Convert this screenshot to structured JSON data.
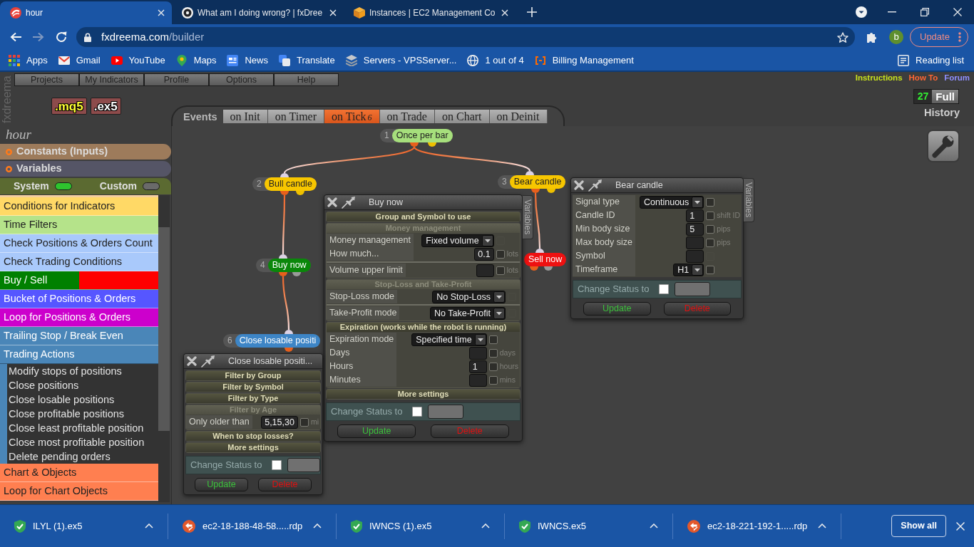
{
  "browser": {
    "tabs": [
      {
        "title": "hour",
        "kind": "swirl",
        "selected": true
      },
      {
        "title": "What am I doing wrong? | fxDree",
        "kind": "ring",
        "selected": false
      },
      {
        "title": "Instances | EC2 Management Co",
        "kind": "cube",
        "selected": false
      }
    ],
    "navigation": [
      {
        "kind": "back",
        "disabled": false
      },
      {
        "kind": "forward",
        "disabled": true
      },
      {
        "kind": "reload",
        "disabled": false
      }
    ],
    "address": {
      "host": "fxdreema.com",
      "path": "/builder"
    },
    "profile": "b",
    "update_button": "Update",
    "bookmarks": [
      {
        "label": "Apps",
        "kind": "grid"
      },
      {
        "label": "Gmail",
        "kind": "mail"
      },
      {
        "label": "YouTube",
        "kind": "video"
      },
      {
        "label": "Maps",
        "kind": "pin"
      },
      {
        "label": "News",
        "kind": "news"
      },
      {
        "label": "Translate",
        "kind": "squares"
      },
      {
        "label": "Servers - VPSServer...",
        "kind": "layers"
      },
      {
        "label": "1 out of 4",
        "kind": "globe"
      },
      {
        "label": "Billing Management",
        "kind": "brackets"
      }
    ],
    "reading_list": "Reading list"
  },
  "app": {
    "brand": "fxdreema",
    "menu": [
      "Projects",
      "My Indicators",
      "Profile",
      "Options",
      "Help"
    ],
    "export_buttons": [
      {
        "label": ".mq5",
        "kind": "source"
      },
      {
        "label": ".ex5",
        "kind": "binary"
      }
    ],
    "events": {
      "label": "Events",
      "tabs": [
        {
          "label": "on Init",
          "selected": false
        },
        {
          "label": "on Timer",
          "selected": false
        },
        {
          "label": "on Tick",
          "count": "6",
          "selected": true
        },
        {
          "label": "on Trade",
          "selected": false
        },
        {
          "label": "on Chart",
          "selected": false
        },
        {
          "label": "on Deinit",
          "selected": false
        }
      ]
    },
    "links": [
      {
        "label": "Instructions",
        "color": "#c8e21c"
      },
      {
        "label": "How To",
        "color": "#ff6633"
      },
      {
        "label": "Forum",
        "color": "#8f8fff"
      }
    ],
    "counter": {
      "value": "27",
      "label": "Full"
    },
    "history": "History",
    "project": "hour",
    "sections": [
      {
        "label": "Constants (Inputs)",
        "color": "#9d7b5b"
      },
      {
        "label": "Variables",
        "color": "#555566"
      }
    ],
    "toggles": [
      {
        "label": "System",
        "on": true
      },
      {
        "label": "Custom",
        "on": false
      }
    ],
    "categories": [
      {
        "label": "Conditions for Indicators",
        "color": "#ffd966",
        "expanded": false
      },
      {
        "label": "Time Filters",
        "color": "#b5e38a",
        "expanded": false
      },
      {
        "label": "Check Positions & Orders Count",
        "color": "#a9c9fb",
        "expanded": false
      },
      {
        "label": "Check Trading Conditions",
        "color": "#a9c9fb",
        "expanded": false
      },
      {
        "label": "Buy / Sell",
        "color": "#008000",
        "second_half": {
          "color": "#ff0000"
        },
        "expanded": false
      },
      {
        "label": "Bucket of Positions & Orders",
        "color": "#5656ff",
        "expanded": false
      },
      {
        "label": "Loop for Positions & Orders",
        "color": "#cc00cc",
        "expanded": false
      },
      {
        "label": "Trailing Stop / Break Even",
        "color": "#4a86b8",
        "expanded": false
      },
      {
        "label": "Trading Actions",
        "color": "#4a86b8",
        "expanded": true,
        "children": [
          {
            "label": "Modify stops of positions"
          },
          {
            "label": "Close positions"
          },
          {
            "label": "Close losable positions"
          },
          {
            "label": "Close profitable positions"
          },
          {
            "label": "Close least profitable position"
          },
          {
            "label": "Close most profitable position"
          },
          {
            "label": "Delete pending orders"
          }
        ]
      },
      {
        "label": "Chart & Objects",
        "color": "#ff7f50",
        "expanded": false
      },
      {
        "label": "Loop for Chart Objects",
        "color": "#ff7f50",
        "expanded": false
      }
    ],
    "nodes": [
      {
        "number": "1",
        "label": "Once per bar",
        "color": "#a6df7c",
        "outputs": [
          {
            "color": "#e8601c"
          },
          {
            "color": "#eec000"
          }
        ],
        "children": [
          {
            "number": "2",
            "label": "Bull candle",
            "color": "#f7c600",
            "outputs": [
              {
                "color": "#e8601c"
              },
              {
                "color": "#eec000"
              }
            ],
            "children": [
              {
                "number": "4",
                "label": "Buy now",
                "color": "#0a870a",
                "outputs": [
                  {
                    "color": "#e8601c"
                  },
                  {
                    "color": "#9a9a9a"
                  }
                ],
                "children": [
                  {
                    "number": "6",
                    "label": "Close losable positi",
                    "color": "#3d85c6",
                    "outputs": [
                      {
                        "color": "#e8601c"
                      }
                    ]
                  }
                ]
              }
            ]
          },
          {
            "number": "3",
            "label": "Bear candle",
            "color": "#f7c600",
            "outputs": [
              {
                "color": "#e8601c"
              },
              {
                "color": "#eec000"
              }
            ],
            "children": [
              {
                "label": "Sell now",
                "color": "#ee1111",
                "outputs": [
                  {
                    "color": "#e8601c"
                  },
                  {
                    "color": "#9a9a9a"
                  }
                ]
              }
            ]
          }
        ]
      }
    ],
    "dialogs": [
      {
        "title": "Bear candle",
        "side_tab": "Variables",
        "sections": [
          {
            "groups": [
              {
                "rows": [
                  {
                    "label": "Signal type",
                    "kind": "select",
                    "value": "Continuous",
                    "checkbox": {
                      "checked": false,
                      "disabled": false
                    }
                  },
                  {
                    "label": "Candle ID",
                    "kind": "input",
                    "value": "1",
                    "unit": "shift ID",
                    "checkbox": {
                      "checked": false,
                      "disabled": false
                    }
                  },
                  {
                    "label": "Min body size",
                    "kind": "input",
                    "value": "5",
                    "unit": "pips",
                    "checkbox": {
                      "checked": false,
                      "disabled": false
                    }
                  },
                  {
                    "label": "Max body size",
                    "kind": "input",
                    "unit": "pips",
                    "checkbox": {
                      "checked": false,
                      "disabled": false
                    }
                  },
                  {
                    "label": "Symbol",
                    "kind": "input",
                    "checkbox": {
                      "checked": false,
                      "disabled": true
                    }
                  },
                  {
                    "label": "Timeframe",
                    "kind": "select",
                    "value": "H1",
                    "checkbox": {
                      "checked": false,
                      "disabled": false
                    }
                  }
                ]
              }
            ]
          }
        ],
        "status": {
          "label": "Change Status to",
          "checked": false
        },
        "buttons": [
          {
            "label": "Update",
            "kind": "update"
          },
          {
            "label": "Delete",
            "kind": "delete"
          }
        ]
      },
      {
        "title": "Buy now",
        "side_tab": "Variables",
        "sections": [
          {
            "title": "Group and Symbol to use",
            "highlighted": true
          },
          {
            "title": "Money management",
            "highlighted": false,
            "groups": [
              {
                "rows": [
                  {
                    "label": "Money management",
                    "kind": "select",
                    "value": "Fixed volume",
                    "checkbox": {
                      "checked": false,
                      "disabled": true
                    }
                  },
                  {
                    "label": "How much...",
                    "kind": "input",
                    "value": "0.1",
                    "unit": "lots",
                    "checkbox": {
                      "checked": false,
                      "disabled": false
                    }
                  }
                ]
              },
              {
                "rows": [
                  {
                    "label": "Volume upper limit",
                    "kind": "input",
                    "unit": "lots",
                    "checkbox": {
                      "checked": false,
                      "disabled": false
                    }
                  }
                ]
              }
            ]
          },
          {
            "title": "Stop-Loss and Take-Profit",
            "highlighted": false,
            "groups": [
              {
                "rows": [
                  {
                    "label": "Stop-Loss mode",
                    "kind": "select",
                    "value": "No Stop-Loss",
                    "checkbox": {
                      "checked": false,
                      "disabled": true
                    }
                  }
                ]
              },
              {
                "rows": [
                  {
                    "label": "Take-Profit mode",
                    "kind": "select",
                    "value": "No Take-Profit",
                    "checkbox": {
                      "checked": false,
                      "disabled": true
                    }
                  }
                ]
              }
            ]
          },
          {
            "title": "Expiration (works while the robot is running)",
            "highlighted": true,
            "groups": [
              {
                "rows": [
                  {
                    "label": "Expiration mode",
                    "kind": "select",
                    "value": "Specified time",
                    "checkbox": {
                      "checked": false,
                      "disabled": false
                    }
                  },
                  {
                    "label": "Days",
                    "kind": "input",
                    "unit": "days",
                    "checkbox": {
                      "checked": false,
                      "disabled": false
                    }
                  },
                  {
                    "label": "Hours",
                    "kind": "input",
                    "value": "1",
                    "unit": "hours",
                    "checkbox": {
                      "checked": false,
                      "disabled": false
                    }
                  },
                  {
                    "label": "Minutes",
                    "kind": "input",
                    "unit": "mins",
                    "checkbox": {
                      "checked": false,
                      "disabled": false
                    }
                  }
                ]
              }
            ]
          },
          {
            "title": "More settings",
            "highlighted": true
          }
        ],
        "status": {
          "label": "Change Status to",
          "checked": false
        },
        "buttons": [
          {
            "label": "Update",
            "kind": "update"
          },
          {
            "label": "Delete",
            "kind": "delete"
          }
        ]
      },
      {
        "title": "Close losable positi...",
        "sections": [
          {
            "title": "Filter by Group",
            "highlighted": true
          },
          {
            "title": "Filter by Symbol",
            "highlighted": true
          },
          {
            "title": "Filter by Type",
            "highlighted": true
          },
          {
            "title": "Filter by Age",
            "highlighted": false,
            "groups": [
              {
                "rows": [
                  {
                    "label": "Only older than",
                    "kind": "input",
                    "value": "5,15,30",
                    "unit": "mi",
                    "checkbox": {
                      "checked": false,
                      "disabled": false
                    }
                  }
                ]
              }
            ]
          },
          {
            "title": "When to stop losses?",
            "highlighted": true
          },
          {
            "title": "More settings",
            "highlighted": true
          }
        ],
        "status": {
          "label": "Change Status to",
          "checked": false
        },
        "buttons": [
          {
            "label": "Update",
            "kind": "update"
          },
          {
            "label": "Delete",
            "kind": "delete"
          }
        ]
      }
    ]
  },
  "downloads": {
    "items": [
      {
        "name": "ILYL (1).ex5",
        "kind": "shield"
      },
      {
        "name": "ec2-18-188-48-58.....rdp",
        "kind": "rdp"
      },
      {
        "name": "IWNCS (1).ex5",
        "kind": "shield"
      },
      {
        "name": "IWNCS.ex5",
        "kind": "shield"
      },
      {
        "name": "ec2-18-221-192-1.....rdp",
        "kind": "rdp"
      }
    ],
    "show_all": "Show all"
  }
}
